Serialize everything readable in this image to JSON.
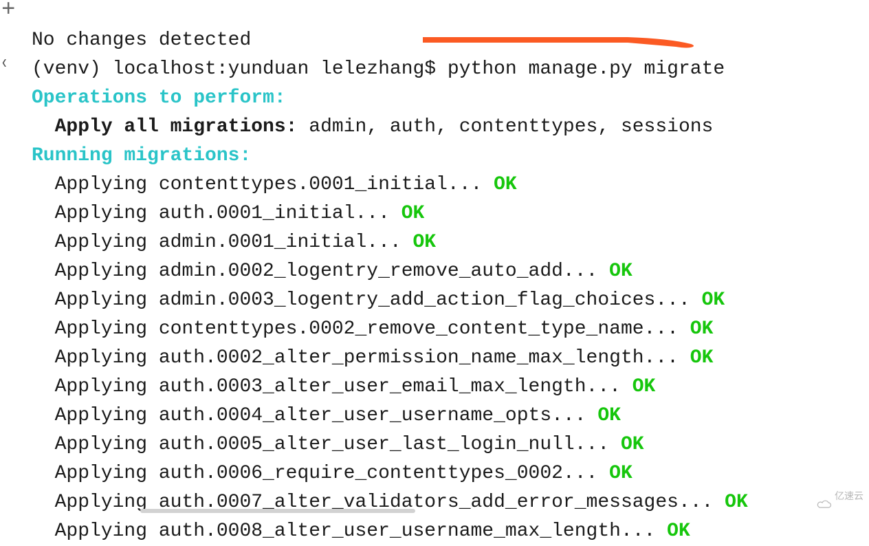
{
  "gutter": {
    "plus": "+",
    "chev": "‹"
  },
  "lines": {
    "line0": "No changes detected",
    "prompt_pre": "(venv) localhost:yunduan lelezhang$ ",
    "prompt_cmd": "python manage.py migrate",
    "ops_header": "Operations to perform:",
    "apply_label": "  Apply all migrations: ",
    "apply_list": "admin, auth, contenttypes, sessions",
    "run_header": "Running migrations:"
  },
  "migrations": [
    {
      "text": "  Applying contenttypes.0001_initial... ",
      "ok": "OK"
    },
    {
      "text": "  Applying auth.0001_initial... ",
      "ok": "OK"
    },
    {
      "text": "  Applying admin.0001_initial... ",
      "ok": "OK"
    },
    {
      "text": "  Applying admin.0002_logentry_remove_auto_add... ",
      "ok": "OK"
    },
    {
      "text": "  Applying admin.0003_logentry_add_action_flag_choices... ",
      "ok": "OK"
    },
    {
      "text": "  Applying contenttypes.0002_remove_content_type_name... ",
      "ok": "OK"
    },
    {
      "text": "  Applying auth.0002_alter_permission_name_max_length... ",
      "ok": "OK"
    },
    {
      "text": "  Applying auth.0003_alter_user_email_max_length... ",
      "ok": "OK"
    },
    {
      "text": "  Applying auth.0004_alter_user_username_opts... ",
      "ok": "OK"
    },
    {
      "text": "  Applying auth.0005_alter_user_last_login_null... ",
      "ok": "OK"
    },
    {
      "text": "  Applying auth.0006_require_contenttypes_0002... ",
      "ok": "OK"
    },
    {
      "text": "  Applying auth.0007_alter_validators_add_error_messages... ",
      "ok": "OK"
    },
    {
      "text": "  Applying auth.0008_alter_user_username_max_length... ",
      "ok": "OK"
    }
  ],
  "watermark": {
    "text": "亿速云"
  },
  "annotation": {
    "color": "#fb5a23"
  }
}
